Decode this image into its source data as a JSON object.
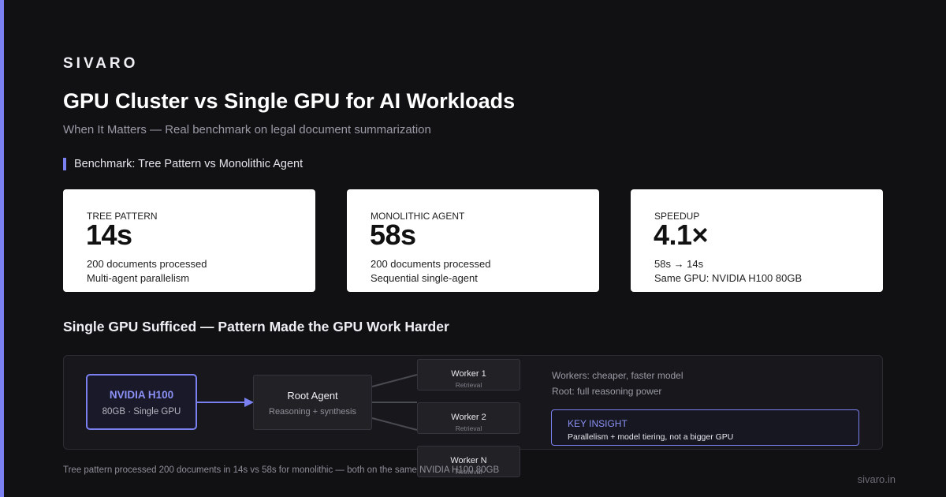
{
  "brand": "SIVARO",
  "title": "GPU Cluster vs Single GPU for AI Workloads",
  "subtitle": "When It Matters — Real benchmark on legal document summarization",
  "section_label": "Benchmark: Tree Pattern vs Monolithic Agent",
  "cards": [
    {
      "label": "TREE PATTERN",
      "value": "14s",
      "line1": "200 documents processed",
      "line2": "Multi-agent parallelism"
    },
    {
      "label": "MONOLITHIC AGENT",
      "value": "58s",
      "line1": "200 documents processed",
      "line2": "Sequential single-agent"
    },
    {
      "label": "SPEEDUP",
      "value": "4.1×",
      "line1": "58s → 14s",
      "line2": "Same GPU: NVIDIA H100 80GB"
    }
  ],
  "section2": "Single GPU Sufficed — Pattern Made the GPU Work Harder",
  "diagram": {
    "gpu": {
      "title": "NVIDIA H100",
      "sub": "80GB · Single GPU"
    },
    "root": {
      "title": "Root Agent",
      "sub": "Reasoning + synthesis"
    },
    "workers": [
      {
        "title": "Worker 1",
        "sub": "Retrieval"
      },
      {
        "title": "Worker 2",
        "sub": "Retrieval"
      },
      {
        "title": "Worker N",
        "sub": "Retrieval"
      }
    ],
    "notes": [
      "Workers: cheaper, faster model",
      "Root: full reasoning power"
    ],
    "insight": {
      "title": "KEY INSIGHT",
      "text": "Parallelism + model tiering, not a bigger GPU"
    }
  },
  "footnote": "Tree pattern processed 200 documents in 14s vs 58s for monolithic — both on the same NVIDIA H100 80GB",
  "site": "sivaro.in",
  "colors": {
    "accent": "#7b80f0",
    "background": "#111114",
    "card": "#ffffff"
  }
}
